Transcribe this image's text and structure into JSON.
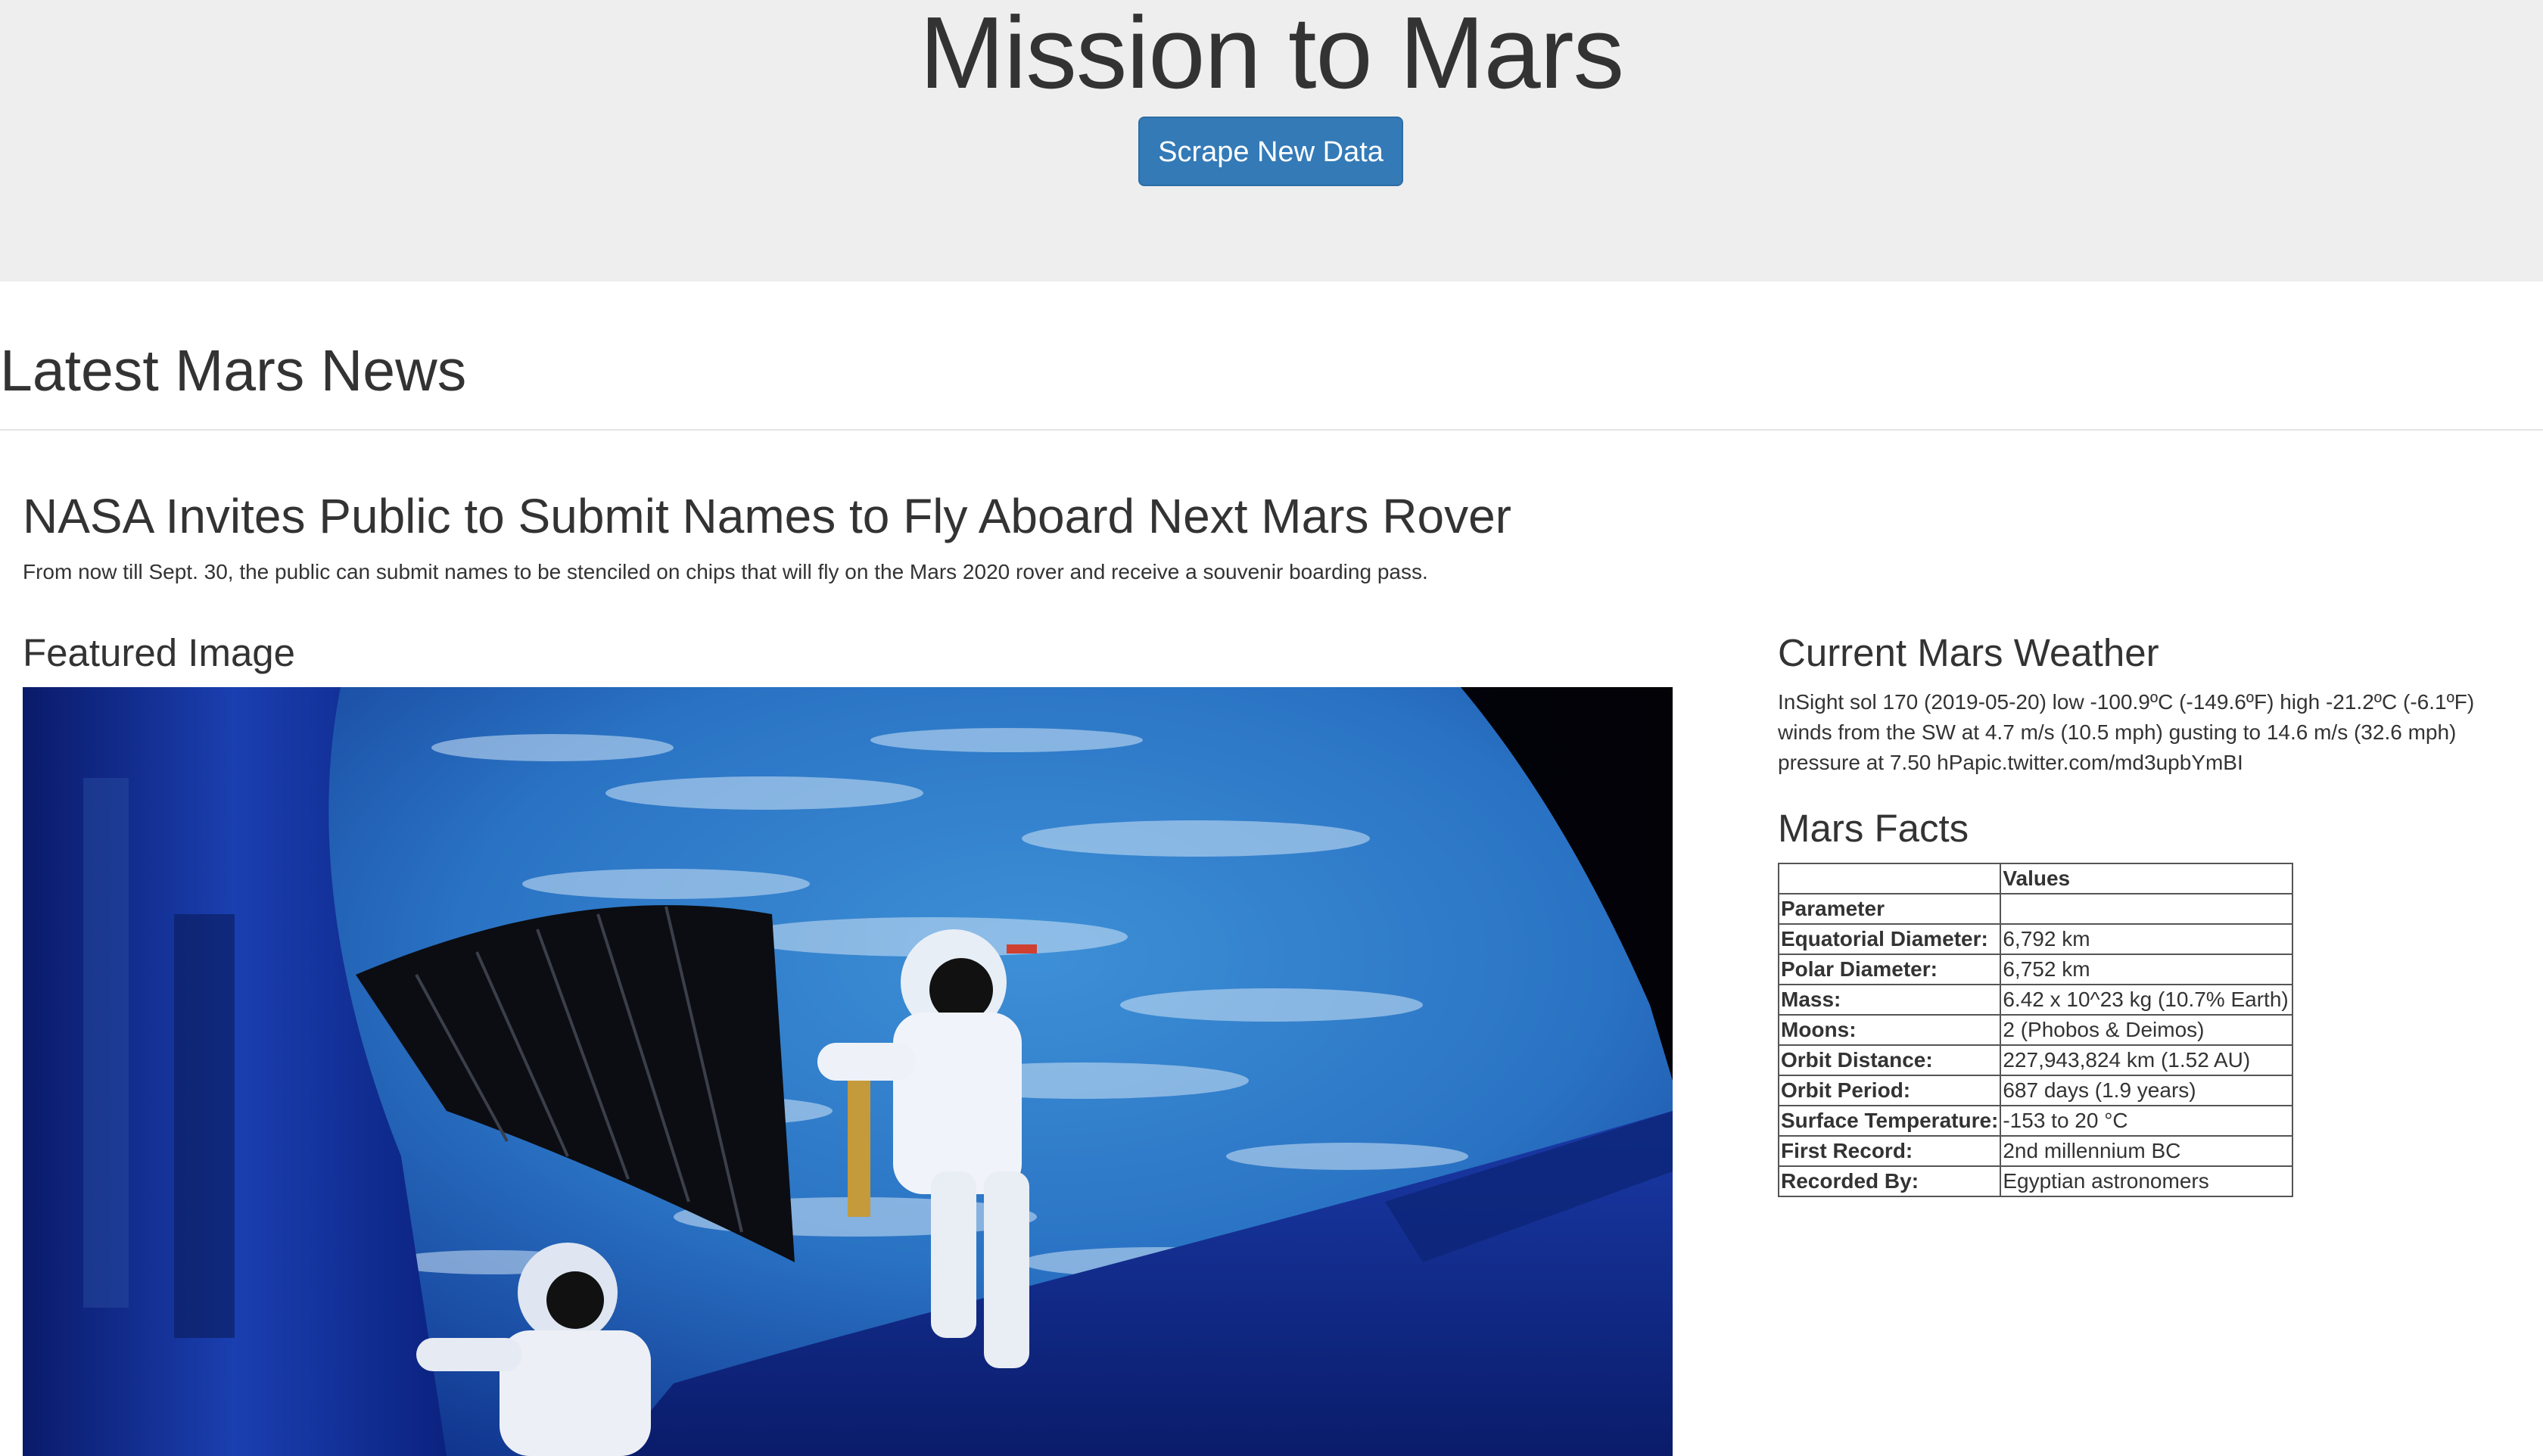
{
  "header": {
    "title": "Mission to Mars",
    "scrape_button_label": "Scrape New Data"
  },
  "news": {
    "section_heading": "Latest Mars News",
    "title": "NASA Invites Public to Submit Names to Fly Aboard Next Mars Rover",
    "teaser": "From now till Sept. 30, the public can submit names to be stenciled on chips that will fly on the Mars 2020 rover and receive a souvenir boarding pass."
  },
  "featured": {
    "heading": "Featured Image",
    "image_description_icon": "astronaut-spacewalk-image"
  },
  "weather": {
    "heading": "Current Mars Weather",
    "text": "InSight sol 170 (2019-05-20) low -100.9ºC (-149.6ºF) high -21.2ºC (-6.1ºF) winds from the SW at 4.7 m/s (10.5 mph) gusting to 14.6 m/s (32.6 mph) pressure at 7.50 hPapic.twitter.com/md3upbYmBI"
  },
  "facts": {
    "heading": "Mars Facts",
    "column_header_label": "",
    "column_header_values": "Values",
    "index_name": "Parameter",
    "rows": [
      {
        "label": "Equatorial Diameter:",
        "value": "6,792 km"
      },
      {
        "label": "Polar Diameter:",
        "value": "6,752 km"
      },
      {
        "label": "Mass:",
        "value": "6.42 x 10^23 kg (10.7% Earth)"
      },
      {
        "label": "Moons:",
        "value": "2 (Phobos & Deimos)"
      },
      {
        "label": "Orbit Distance:",
        "value": "227,943,824 km (1.52 AU)"
      },
      {
        "label": "Orbit Period:",
        "value": "687 days (1.9 years)"
      },
      {
        "label": "Surface Temperature:",
        "value": "-153 to 20 °C"
      },
      {
        "label": "First Record:",
        "value": "2nd millennium BC"
      },
      {
        "label": "Recorded By:",
        "value": "Egyptian astronomers"
      }
    ]
  }
}
